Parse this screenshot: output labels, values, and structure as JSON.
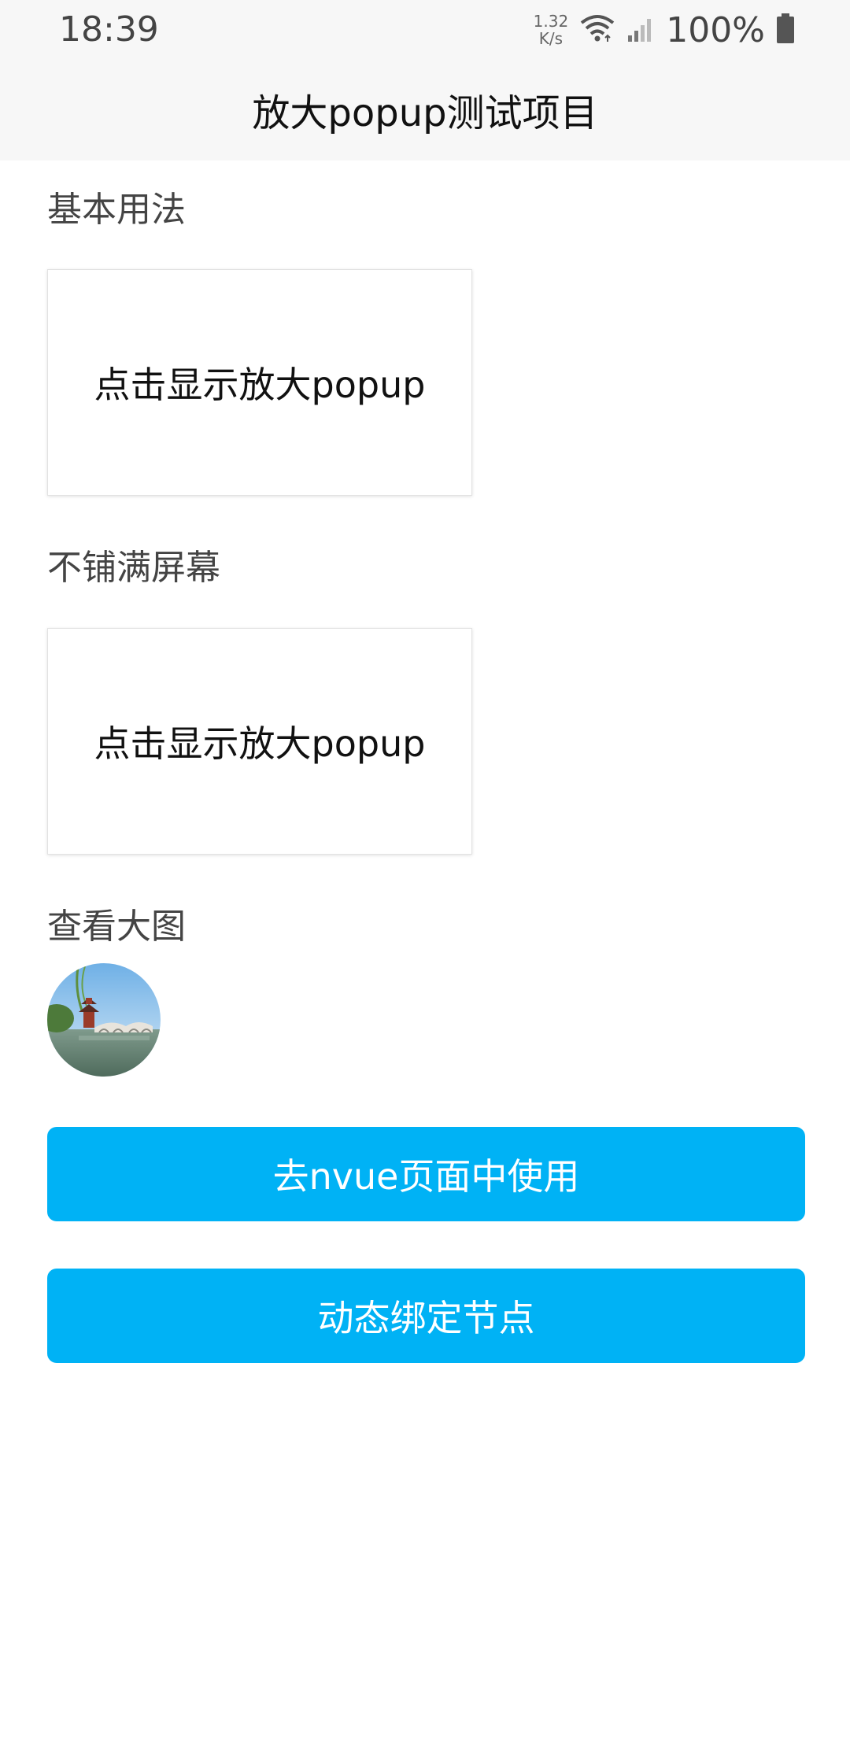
{
  "status_bar": {
    "time": "18:39",
    "net_speed_value": "1.32",
    "net_speed_unit": "K/s",
    "battery": "100%",
    "icons": [
      "wifi-icon",
      "signal-icon",
      "battery-icon"
    ]
  },
  "nav": {
    "title": "放大popup测试项目"
  },
  "sections": {
    "basic": {
      "title": "基本用法",
      "button_label": "点击显示放大popup"
    },
    "not_fullscreen": {
      "title": "不铺满屏幕",
      "button_label": "点击显示放大popup"
    },
    "view_image": {
      "title": "查看大图"
    }
  },
  "buttons": {
    "nvue": "去nvue页面中使用",
    "dynamic_bind": "动态绑定节点"
  },
  "colors": {
    "accent": "#00b2f5",
    "nav_bg": "#f7f7f7"
  }
}
